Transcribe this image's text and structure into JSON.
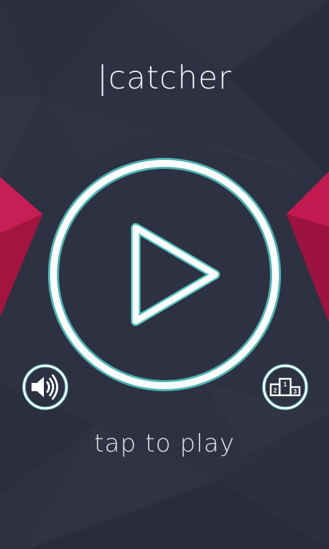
{
  "app": {
    "title": "|catcher",
    "hint": "tap to play"
  },
  "icons": {
    "play": "play-icon",
    "sound": "speaker-icon",
    "leaderboard": "podium-icon"
  },
  "podium_numbers": [
    "1",
    "2",
    "3"
  ],
  "colors": {
    "background": "#2e3141",
    "accent_ring": "#4fc3c0",
    "crimson": "#b8174a",
    "white": "#ffffff"
  }
}
